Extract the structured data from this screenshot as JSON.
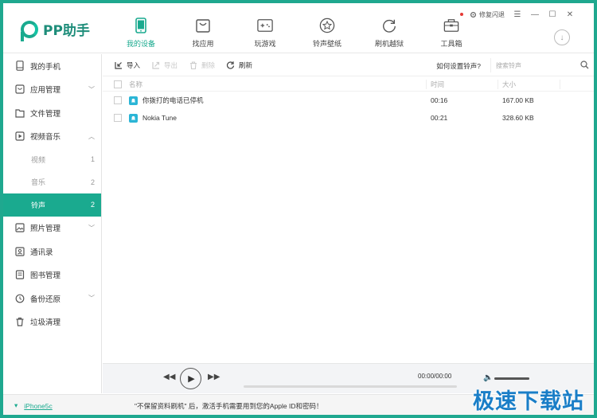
{
  "app": {
    "logo_text": "PP助手"
  },
  "nav": [
    {
      "label": "我的设备",
      "icon": "phone-icon",
      "active": true
    },
    {
      "label": "找应用",
      "icon": "app-bag-icon"
    },
    {
      "label": "玩游戏",
      "icon": "gamepad-icon"
    },
    {
      "label": "铃声壁纸",
      "icon": "star-icon"
    },
    {
      "label": "刷机越狱",
      "icon": "refresh-circle-icon"
    },
    {
      "label": "工具箱",
      "icon": "toolbox-icon",
      "badge": true
    }
  ],
  "topbar": {
    "repair_label": "修复闪退"
  },
  "sidebar": {
    "items": [
      {
        "label": "我的手机",
        "icon": "phone-outline-icon"
      },
      {
        "label": "应用管理",
        "icon": "app-icon",
        "chevron": "﹀"
      },
      {
        "label": "文件管理",
        "icon": "folder-icon"
      },
      {
        "label": "视频音乐",
        "icon": "video-icon",
        "chevron": "︿"
      }
    ],
    "subitems": [
      {
        "label": "视频",
        "count": "1"
      },
      {
        "label": "音乐",
        "count": "2"
      },
      {
        "label": "铃声",
        "count": "2",
        "active": true
      }
    ],
    "items2": [
      {
        "label": "照片管理",
        "icon": "photo-icon",
        "chevron": "﹀"
      },
      {
        "label": "通讯录",
        "icon": "contacts-icon"
      },
      {
        "label": "图书管理",
        "icon": "book-icon"
      },
      {
        "label": "备份还原",
        "icon": "backup-icon",
        "chevron": "﹀"
      },
      {
        "label": "垃圾清理",
        "icon": "trash-icon"
      }
    ]
  },
  "toolbar": {
    "import_label": "导入",
    "export_label": "导出",
    "delete_label": "删除",
    "refresh_label": "刷新",
    "howto_label": "如何设置铃声?",
    "search_placeholder": "搜索铃声"
  },
  "table": {
    "headers": {
      "name": "名称",
      "time": "时间",
      "size": "大小"
    },
    "rows": [
      {
        "name": "你拨打的电话已停机",
        "time": "00:16",
        "size": "167.00 KB"
      },
      {
        "name": "Nokia Tune",
        "time": "00:21",
        "size": "328.60 KB"
      }
    ]
  },
  "player": {
    "time": "00:00/00:00",
    "progress": 0,
    "volume": 1.0
  },
  "status": {
    "device_name": "iPhone5c",
    "notice": "\"不保留资料刷机\" 后，激活手机需要用到您的Apple ID和密码！"
  },
  "watermark": "极速下载站",
  "colors": {
    "accent": "#1aaa8f",
    "frame": "#1fa88f",
    "ringtone_icon": "#2bb5d6"
  }
}
